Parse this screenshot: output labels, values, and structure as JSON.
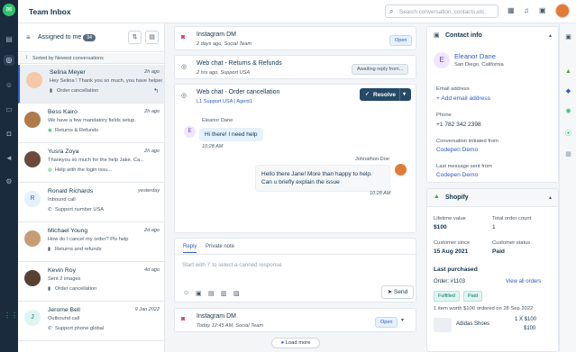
{
  "app": {
    "title": "Team Inbox",
    "search_placeholder": "Search conversation, contacts,etc."
  },
  "left": {
    "assigned_label": "Assigned to me",
    "assigned_count": "34",
    "sort_label": "Sorted by Newest conversations",
    "conversations": [
      {
        "name": "Selina Meyer",
        "preview": "Hey Selina ! Thank you so much, you have helped...",
        "channel": "Order cancellation",
        "time": "2h ago",
        "color": "#f3c9a8"
      },
      {
        "name": "Bess Kairo",
        "preview": "We have a few mandatory fields setup.",
        "channel": "Returns & Refunds",
        "time": "2h ago",
        "color": "#b07a4a"
      },
      {
        "name": "Yusra Zoya",
        "preview": "Thankyou so much for the help Jake. Ca...",
        "channel": "Help with the login issu...",
        "time": "2h ago",
        "color": "#6b4a3a"
      },
      {
        "name": "Ronald Richards",
        "preview": "Inbound call",
        "channel": "Support number USA",
        "time": "yesterday",
        "initial": "R",
        "color": "#e5f2fd"
      },
      {
        "name": "Michael Young",
        "preview": "How do I cancel my order? Pls help",
        "channel": "Returns and refunds",
        "time": "2d ago",
        "color": "#c79c75"
      },
      {
        "name": "Kevin Roy",
        "preview": "Sent 2 images",
        "channel": "Order cancellation",
        "time": "4d ago",
        "color": "#5a4030"
      },
      {
        "name": "Jerome Bell",
        "preview": "Outbound call",
        "channel": "Support phone global",
        "time": "9 Jan 2022",
        "initial": "J",
        "color": "#e0f5f1"
      }
    ]
  },
  "middle": {
    "cards": [
      {
        "title": "Instagram DM",
        "subtitle": "2 days ago, Social Team",
        "status": "Open"
      },
      {
        "title": "Web chat - Returns & Refunds",
        "subtitle": "2 hrs ago, Support USA",
        "status": "Awaiting reply from..."
      },
      {
        "title": "Web chat - Order cancellation",
        "subtitle": "L1 Support USA | Agent1",
        "status": "Resolve"
      }
    ],
    "incoming": {
      "name": "Eleanor Dane",
      "initial": "E",
      "text": "Hi there! I need help",
      "time": "10:28 AM"
    },
    "outgoing": {
      "name": "Johnathon Doe",
      "line1": "Hello there Jane! More than happy to help.",
      "line2": "Can u briefly explain the issue",
      "time": "10:28 AM"
    },
    "composer": {
      "tab_reply": "Reply",
      "tab_note": "Private note",
      "placeholder": "Start with '/' to select a canned response",
      "send_label": "Send"
    },
    "bottom_card": {
      "title": "Instagram DM",
      "subtitle": "Today 12:45 AM, Social Team",
      "status": "Open"
    },
    "load_more": "Load more"
  },
  "contact": {
    "header": "Contact info",
    "initial": "E",
    "name": "Eleanor Dane",
    "location": "San Diego, California",
    "email_label": "Email address",
    "email_action": "+ Add email address",
    "phone_label": "Phone",
    "phone": "+1 782 342 2398",
    "initiated_label": "Conversation initiated from",
    "initiated": "Codepen Demo",
    "last_msg_label": "Last message sent from",
    "last_msg": "Codepen Demo"
  },
  "shopify": {
    "header": "Shopify",
    "lifetime_label": "Lifetime value",
    "lifetime": "$100",
    "total_orders_label": "Total order count",
    "total_orders": "1",
    "since_label": "Customer since",
    "since": "15 Aug 2021",
    "status_label": "Customer status",
    "status": "Paid",
    "last_purchased": "Last purchased",
    "order_label": "Order: #1103",
    "view_all": "View all orders",
    "tag1": "Fulfilled",
    "tag2": "Paid",
    "items_line": "1 item worth $100 ordered on 28 Sep 2022",
    "product": "Adidas Shoes",
    "qty_price": "1 X $100",
    "total": "$100"
  }
}
